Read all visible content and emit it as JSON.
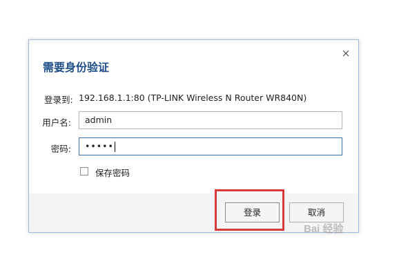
{
  "dialog": {
    "title": "需要身份验证",
    "close_glyph": "×",
    "server_label": "登录到:",
    "server_value": "192.168.1.1:80 (TP-LINK Wireless N Router WR840N)",
    "username_label": "用户名:",
    "username_value": "admin",
    "password_label": "密码:",
    "password_value": "•••••",
    "remember_label": "保存密码",
    "remember_checked": false,
    "login_label": "登录",
    "cancel_label": "取消"
  },
  "colors": {
    "title": "#1f4f88",
    "highlight": "#d63a3a",
    "footer_bg": "#f4f4f4"
  },
  "icons": {
    "close": "close-icon"
  },
  "watermark": {
    "text": "Bai 经验"
  }
}
